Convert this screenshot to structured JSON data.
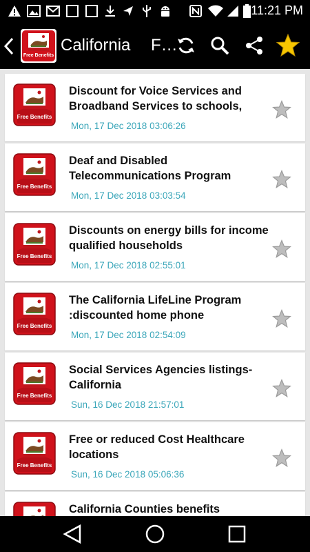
{
  "status_bar": {
    "time": "11:21 PM",
    "icons": [
      "warning-icon",
      "image-icon",
      "gmail-icon",
      "square-icon",
      "download-icon",
      "send-icon",
      "usb-icon",
      "android-icon",
      "nfc-icon",
      "wifi-icon",
      "signal-icon",
      "battery-icon"
    ]
  },
  "app_bar": {
    "title": "California",
    "second_title": "F…",
    "logo_text": "Free Benefits",
    "actions": [
      "refresh-icon",
      "search-icon",
      "share-icon",
      "favorite-star-icon"
    ],
    "star_color": "#f7c600"
  },
  "list": {
    "items": [
      {
        "title": "Discount for Voice Services and Broadband Services to schools, librarie…",
        "date": "Mon, 17 Dec 2018 03:06:26",
        "thumb_text": "Free Benefits"
      },
      {
        "title": "Deaf and Disabled Telecommunications Program",
        "date": "Mon, 17 Dec 2018 03:03:54",
        "thumb_text": "Free Benefits"
      },
      {
        "title": "Discounts on energy bills for income qualified households",
        "date": "Mon, 17 Dec 2018 02:55:01",
        "thumb_text": "Free Benefits"
      },
      {
        "title": "The California LifeLine Program :discounted home phone",
        "date": "Mon, 17 Dec 2018 02:54:09",
        "thumb_text": "Free Benefits"
      },
      {
        "title": "Social Services Agencies  listings-California",
        "date": "Sun, 16 Dec 2018 21:57:01",
        "thumb_text": "Free Benefits"
      },
      {
        "title": "Free or reduced Cost Healthcare locations",
        "date": "Sun, 16 Dec 2018 05:06:36",
        "thumb_text": "Free Benefits"
      },
      {
        "title": "California Counties benefits application",
        "date": "",
        "thumb_text": "Free Benefits"
      }
    ]
  },
  "colors": {
    "accent_date": "#3aa6b9",
    "thumb_red": "#d0121b"
  },
  "nav_bar": {
    "buttons": [
      "back-triangle-icon",
      "home-circle-icon",
      "recents-square-icon"
    ]
  }
}
